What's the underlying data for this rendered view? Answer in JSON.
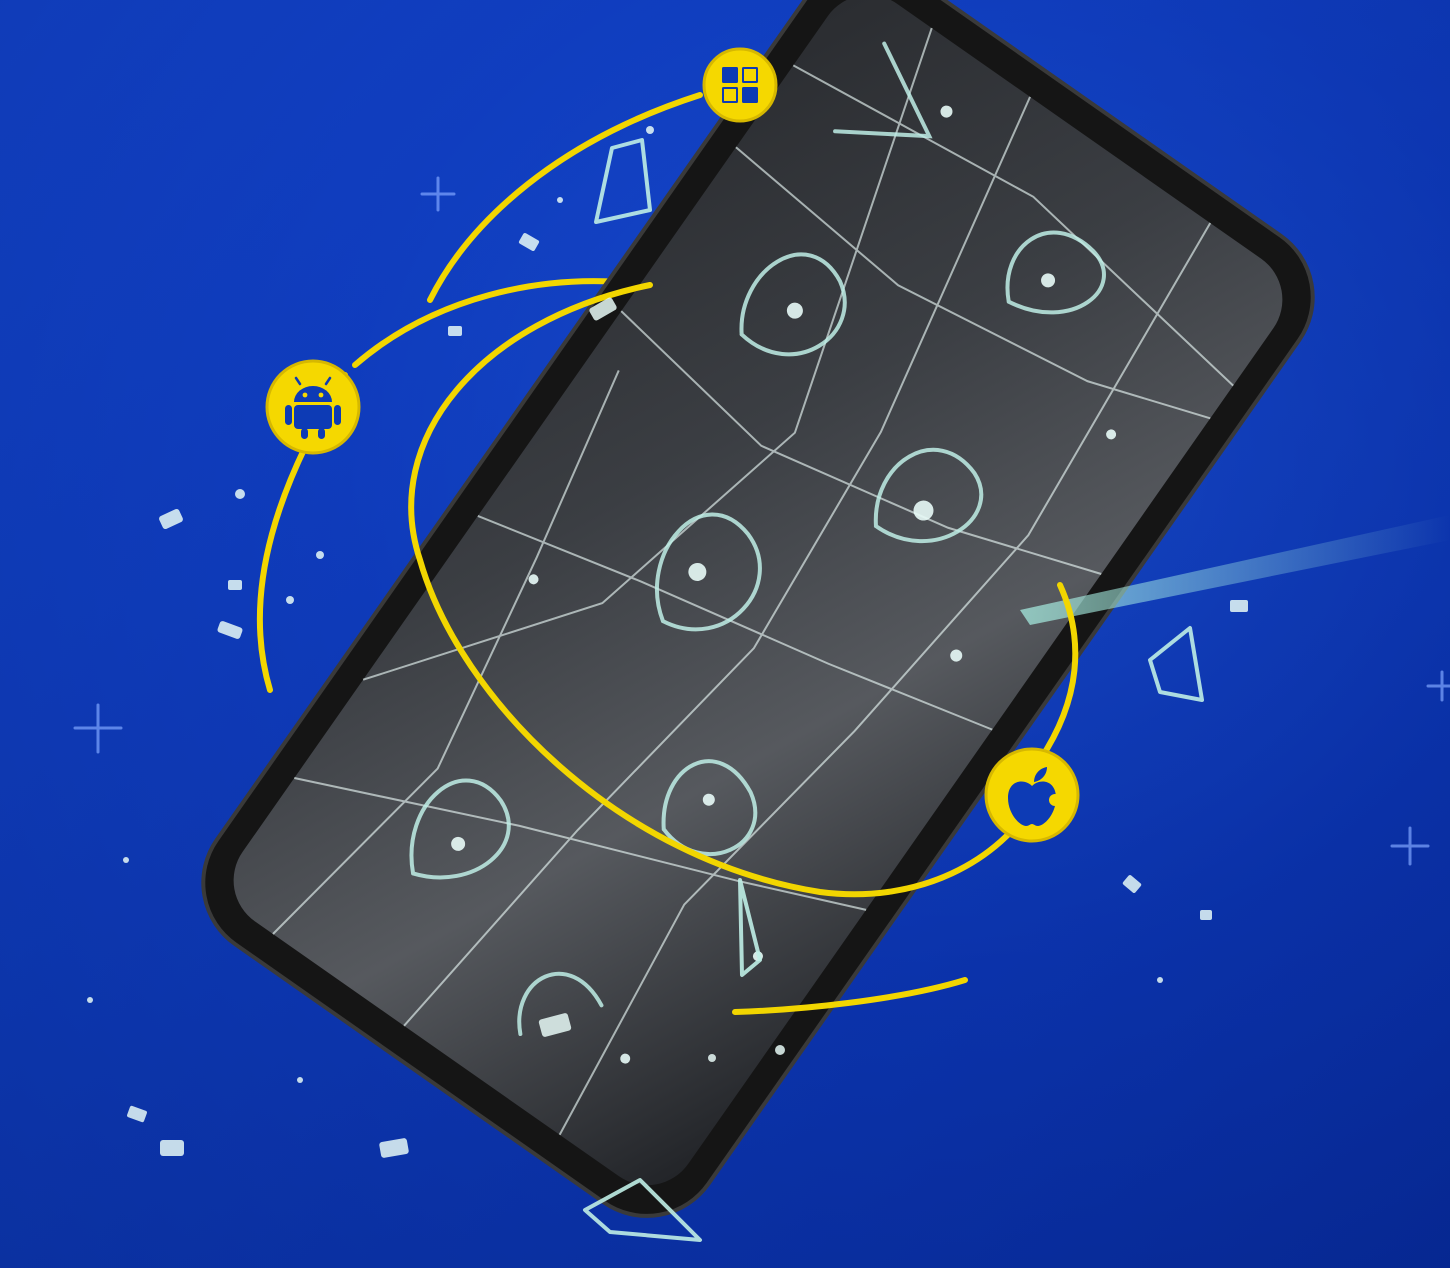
{
  "scene": {
    "subject": "shattered-smartphone",
    "colors": {
      "background": "#0b35b8",
      "background_light": "#1d57e0",
      "orbit": "#f2d600",
      "badge_fill": "#f5d800",
      "badge_icon": "#0d3bb5",
      "phone_body": "#151515",
      "screen": "#3a3d42",
      "glass": "#bfeee6",
      "crack": "#e6f4f2",
      "sparkle": "#7fa6ff"
    },
    "badges": [
      {
        "id": "windows",
        "icon": "windows-icon"
      },
      {
        "id": "android",
        "icon": "android-icon"
      },
      {
        "id": "apple",
        "icon": "apple-icon"
      }
    ]
  }
}
